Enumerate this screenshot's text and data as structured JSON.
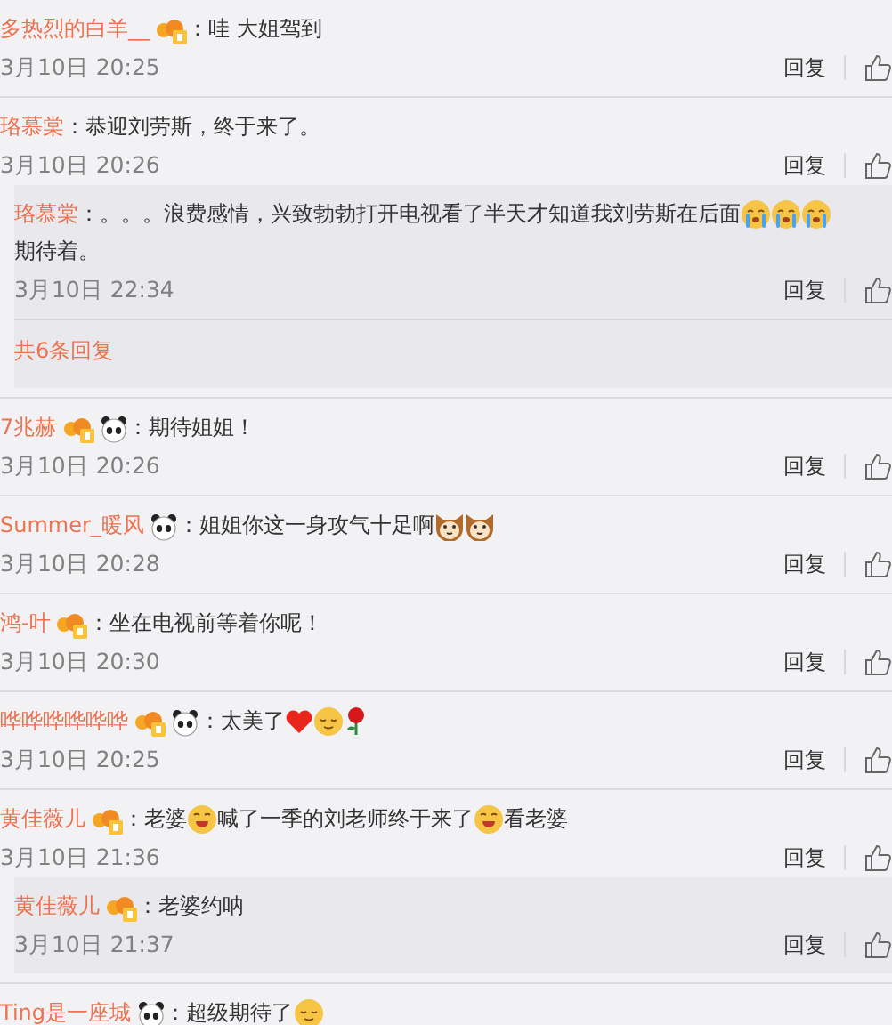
{
  "comments": [
    {
      "user": "多热烈的白羊__",
      "badges": [
        {
          "kind": "vip"
        }
      ],
      "parts": [
        {
          "kind": "text",
          "text": "：哇 大姐驾到"
        }
      ],
      "time": "3月10日 20:25",
      "reply": "回复"
    },
    {
      "user": "珞慕棠",
      "parts": [
        {
          "kind": "text",
          "text": "：恭迎刘劳斯，终于来了。"
        }
      ],
      "time": "3月10日 20:26",
      "reply": "回复",
      "replies": [
        {
          "user": "珞慕棠",
          "parts": [
            {
              "kind": "text",
              "text": "：。。。浪费感情，兴致勃勃打开电视看了半天才知道我刘劳斯在后面"
            },
            {
              "kind": "cry"
            },
            {
              "kind": "cry"
            },
            {
              "kind": "cry"
            },
            {
              "kind": "text",
              "text": "期待着。"
            }
          ],
          "time": "3月10日 22:34",
          "reply": "回复"
        }
      ],
      "more": "共6条回复"
    },
    {
      "user": "7兆赫",
      "badges": [
        {
          "kind": "vip"
        },
        {
          "kind": "panda"
        }
      ],
      "parts": [
        {
          "kind": "text",
          "text": "：期待姐姐！"
        }
      ],
      "time": "3月10日 20:26",
      "reply": "回复"
    },
    {
      "user": "Summer_暖风",
      "badges": [
        {
          "kind": "panda"
        }
      ],
      "parts": [
        {
          "kind": "text",
          "text": "：姐姐你这一身攻气十足啊"
        },
        {
          "kind": "dog"
        },
        {
          "kind": "dog"
        }
      ],
      "time": "3月10日 20:28",
      "reply": "回复"
    },
    {
      "user": "鸿-叶",
      "badges": [
        {
          "kind": "vip"
        }
      ],
      "parts": [
        {
          "kind": "text",
          "text": "：坐在电视前等着你呢！"
        }
      ],
      "time": "3月10日 20:30",
      "reply": "回复"
    },
    {
      "user": "哗哗哗哗哗哗",
      "badges": [
        {
          "kind": "vip"
        },
        {
          "kind": "panda"
        }
      ],
      "parts": [
        {
          "kind": "text",
          "text": "：太美了"
        },
        {
          "kind": "heart"
        },
        {
          "kind": "smile"
        },
        {
          "kind": "rose"
        }
      ],
      "time": "3月10日 20:25",
      "reply": "回复"
    },
    {
      "user": "黄佳薇儿",
      "badges": [
        {
          "kind": "vip"
        }
      ],
      "parts": [
        {
          "kind": "text",
          "text": "：老婆"
        },
        {
          "kind": "grin"
        },
        {
          "kind": "text",
          "text": "喊了一季的刘老师终于来了"
        },
        {
          "kind": "grin"
        },
        {
          "kind": "text",
          "text": "看老婆"
        }
      ],
      "time": "3月10日 21:36",
      "reply": "回复",
      "replies": [
        {
          "user": "黄佳薇儿",
          "badges": [
            {
              "kind": "vip"
            }
          ],
          "parts": [
            {
              "kind": "text",
              "text": "：老婆约呐"
            }
          ],
          "time": "3月10日 21:37",
          "reply": "回复"
        }
      ]
    },
    {
      "user": "Ting是一座城",
      "badges": [
        {
          "kind": "panda"
        }
      ],
      "parts": [
        {
          "kind": "text",
          "text": "：超级期待了"
        },
        {
          "kind": "smile"
        }
      ]
    }
  ]
}
